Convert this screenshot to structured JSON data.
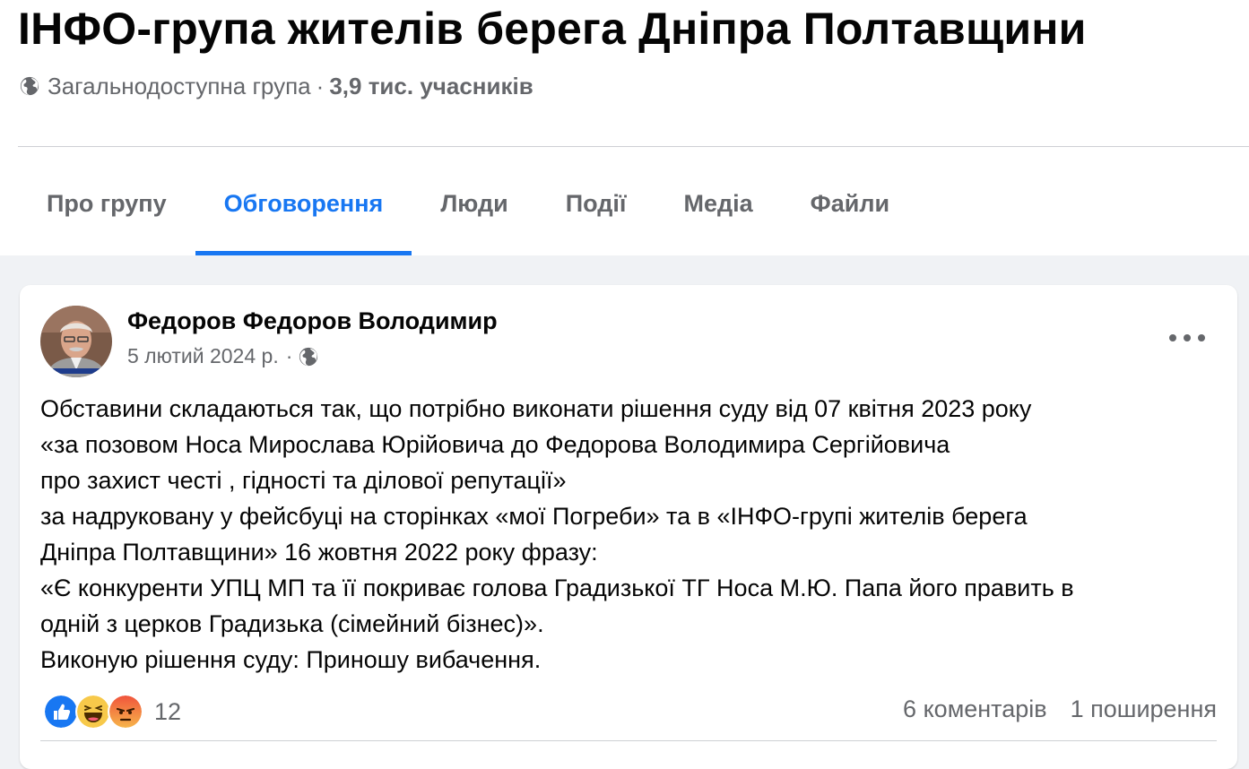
{
  "group": {
    "title": "ІНФО-група жителів берега Дніпра Полтавщини",
    "privacy": "Загальнодоступна група",
    "separator": "·",
    "members": "3,9 тис. учасників"
  },
  "tabs": [
    {
      "label": "Про групу",
      "active": false
    },
    {
      "label": "Обговорення",
      "active": true
    },
    {
      "label": "Люди",
      "active": false
    },
    {
      "label": "Події",
      "active": false
    },
    {
      "label": "Медіа",
      "active": false
    },
    {
      "label": "Файли",
      "active": false
    }
  ],
  "post": {
    "author": "Федоров Федоров Володимир",
    "date": "5 лютий 2024 р.",
    "meta_separator": "·",
    "audience_icon": "globe-icon",
    "body_lines": [
      "Обставини складаються так, що потрібно виконати рішення суду від 07 квітня 2023 року",
      "«за позовом Носа Мирослава Юрійовича до Федорова Володимира Сергійовича",
      "про захист честі , гідності та ділової репутації»",
      "за надруковану у фейсбуці на сторінках «мої Погреби» та в «ІНФО-групі жителів берега",
      "Дніпра Полтавщини» 16 жовтня 2022 року фразу:",
      "«Є конкуренти УПЦ МП та її покриває голова Градизької ТГ Носа М.Ю. Папа його править в",
      "одній з церков Градизька (сімейний бізнес)».",
      "Виконую рішення суду: Приношу вибачення."
    ],
    "reaction_icons": [
      "like-icon",
      "haha-icon",
      "angry-icon"
    ],
    "reaction_count": "12",
    "comments": "6 коментарів",
    "shares": "1 поширення"
  },
  "colors": {
    "accent": "#1877f2",
    "secondary_text": "#65676b",
    "background": "#f0f2f5"
  }
}
